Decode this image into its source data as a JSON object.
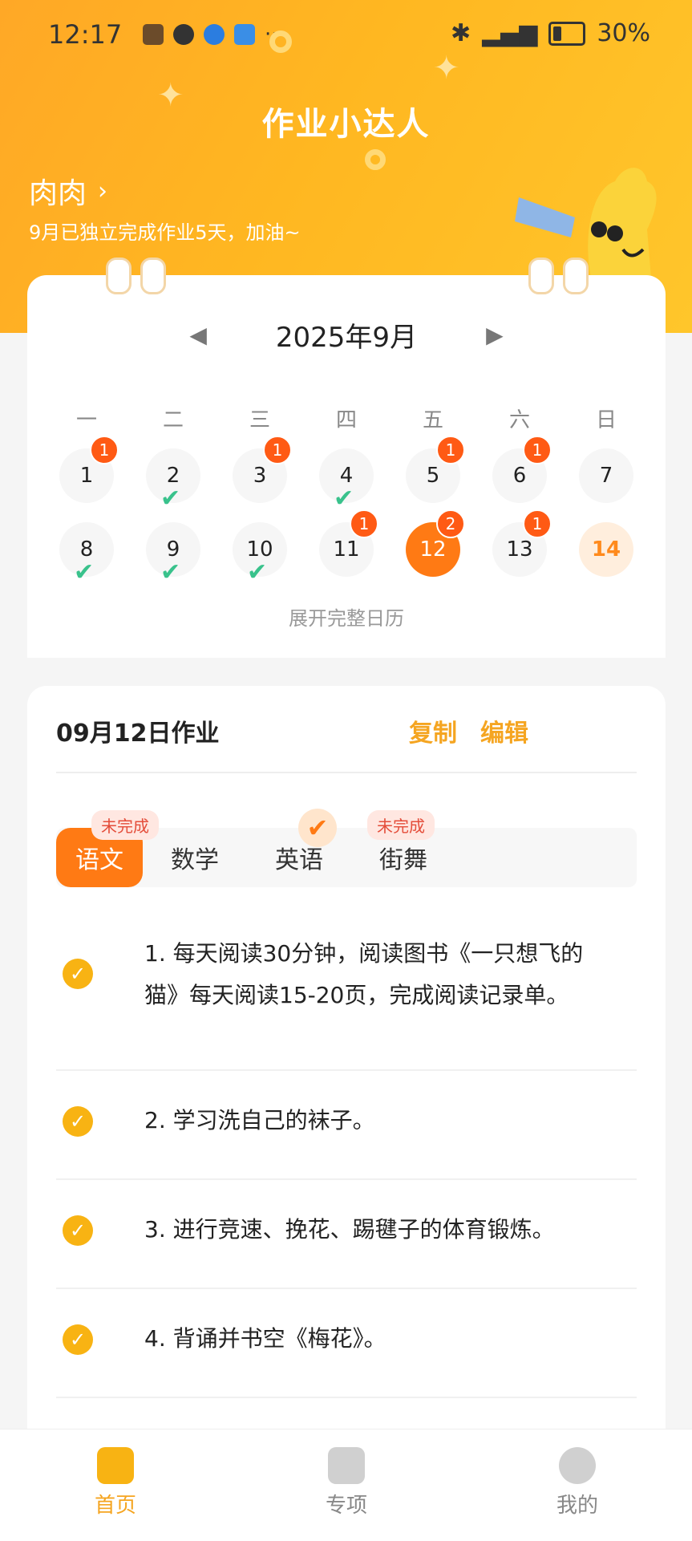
{
  "status_bar": {
    "time": "12:17",
    "battery": "30%"
  },
  "app": {
    "title": "作业小达人"
  },
  "user": {
    "name": "肉肉",
    "summary": "9月已独立完成作业5天，加油~"
  },
  "calendar": {
    "month": "2025年9月",
    "weekdays": [
      "一",
      "二",
      "三",
      "四",
      "五",
      "六",
      "日"
    ],
    "days": [
      {
        "day": "1",
        "badge": "1",
        "done": false
      },
      {
        "day": "2",
        "badge": "",
        "done": true
      },
      {
        "day": "3",
        "badge": "1",
        "done": false
      },
      {
        "day": "4",
        "badge": "",
        "done": true
      },
      {
        "day": "5",
        "badge": "1",
        "done": false
      },
      {
        "day": "6",
        "badge": "1",
        "done": false
      },
      {
        "day": "7",
        "badge": "",
        "done": false
      },
      {
        "day": "8",
        "badge": "",
        "done": true
      },
      {
        "day": "9",
        "badge": "",
        "done": true
      },
      {
        "day": "10",
        "badge": "",
        "done": true
      },
      {
        "day": "11",
        "badge": "1",
        "done": false
      },
      {
        "day": "12",
        "badge": "2",
        "done": false,
        "selected": true
      },
      {
        "day": "13",
        "badge": "1",
        "done": false
      },
      {
        "day": "14",
        "badge": "",
        "done": false,
        "today": true
      }
    ],
    "expand_label": "展开完整日历"
  },
  "homework": {
    "title": "09月12日作业",
    "copy_label": "复制",
    "edit_label": "编辑",
    "tabs": [
      {
        "label": "语文",
        "tag": "未完成",
        "active": true
      },
      {
        "label": "数学",
        "tag": ""
      },
      {
        "label": "英语",
        "tag": "✔"
      },
      {
        "label": "街舞",
        "tag": "未完成"
      }
    ],
    "items": [
      "1. 每天阅读30分钟，阅读图书《一只想飞的猫》每天阅读15-20页，完成阅读记录单。",
      "2. 学习洗自己的袜子。",
      "3. 进行竞速、挽花、踢毽子的体育锻炼。",
      "4. 背诵并书空《梅花》。"
    ]
  },
  "nav": {
    "home": "首页",
    "special": "专项",
    "mine": "我的"
  },
  "colors": {
    "accent": "#ff7a14",
    "brand": "#ffb721",
    "done": "#39c28c"
  }
}
